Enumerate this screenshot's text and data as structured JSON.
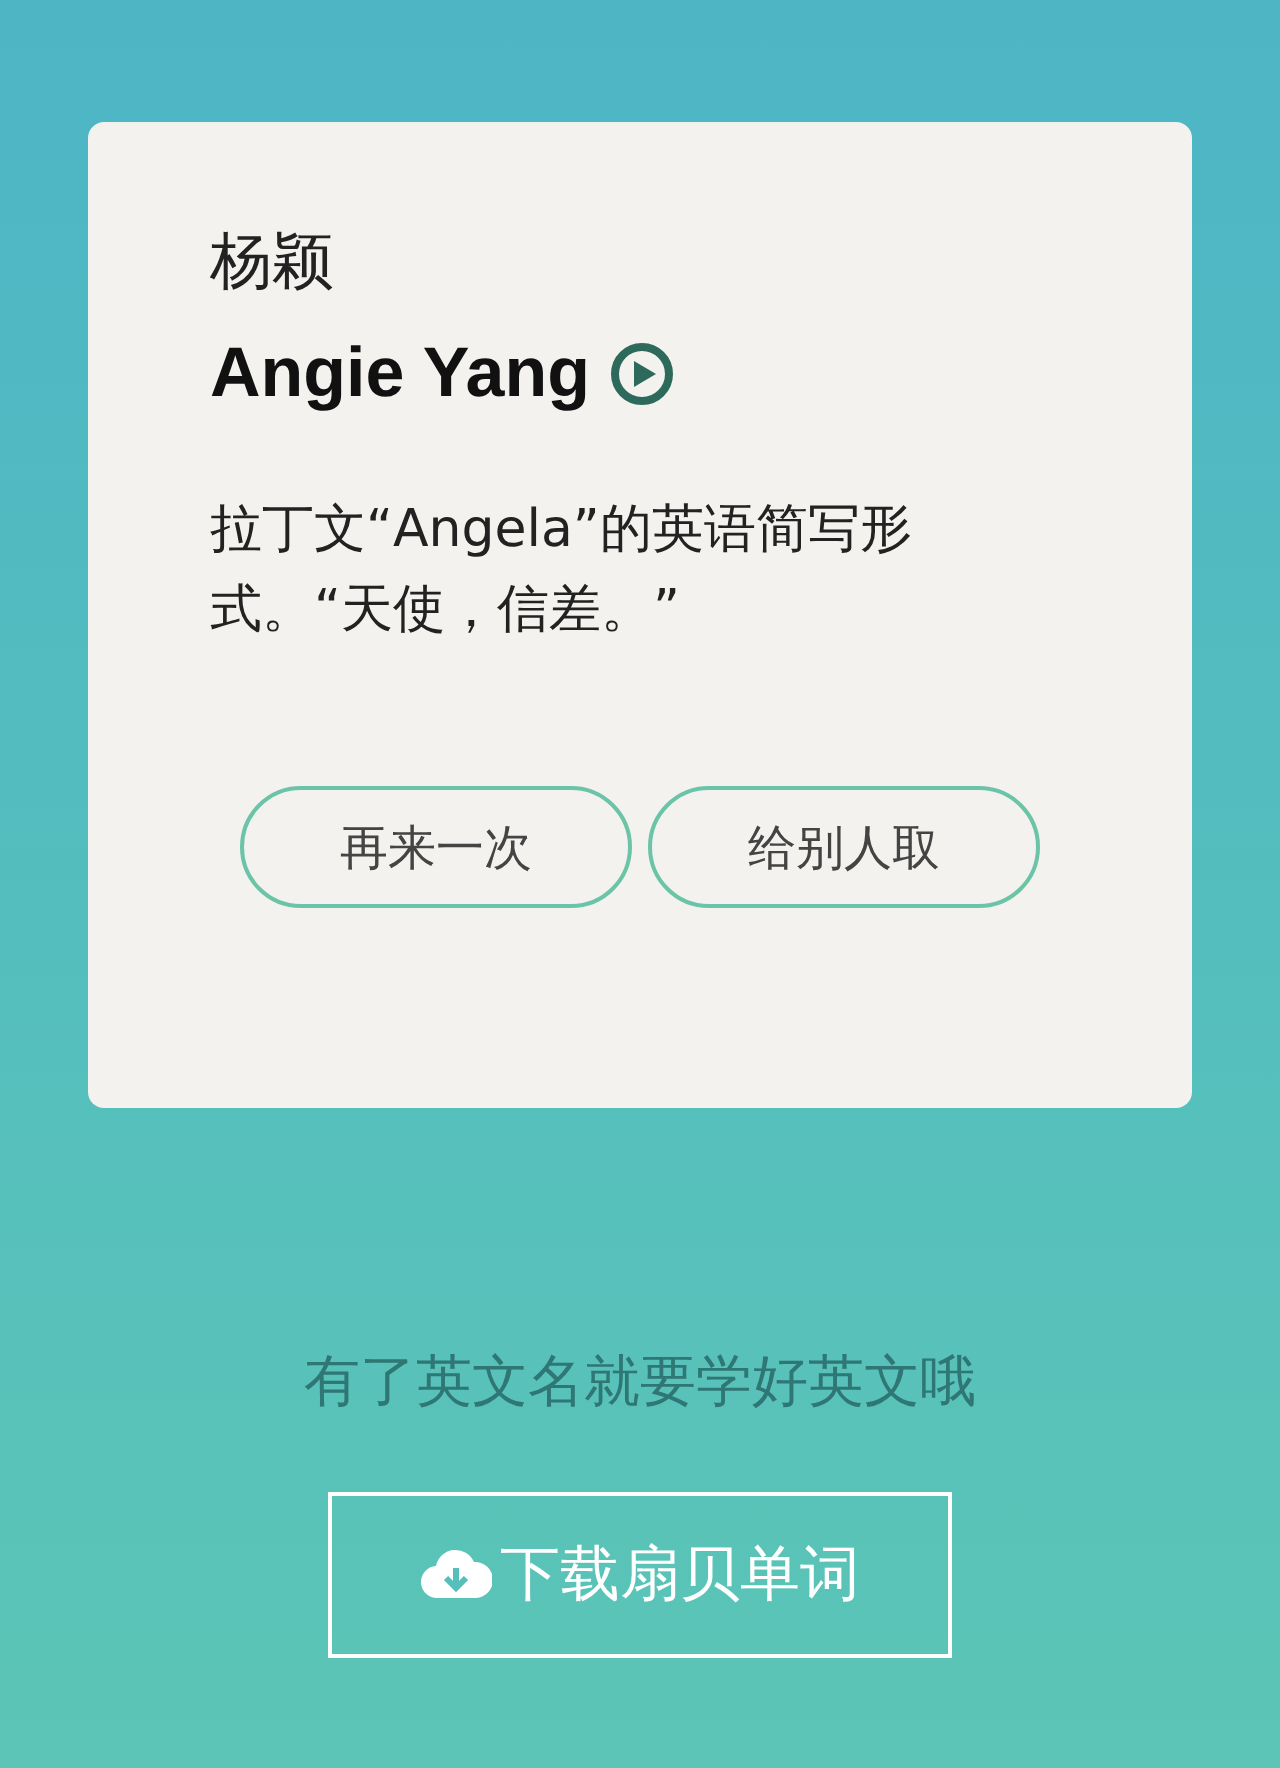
{
  "card": {
    "chinese_name": "杨颖",
    "english_name": "Angie Yang",
    "description": "拉丁文“Angela”的英语简写形式。“天使，信差。”",
    "buttons": [
      {
        "label": "再来一次"
      },
      {
        "label": "给别人取"
      }
    ]
  },
  "tagline": "有了英文名就要学好英文哦",
  "download_button": {
    "label": "下载扇贝单词"
  }
}
